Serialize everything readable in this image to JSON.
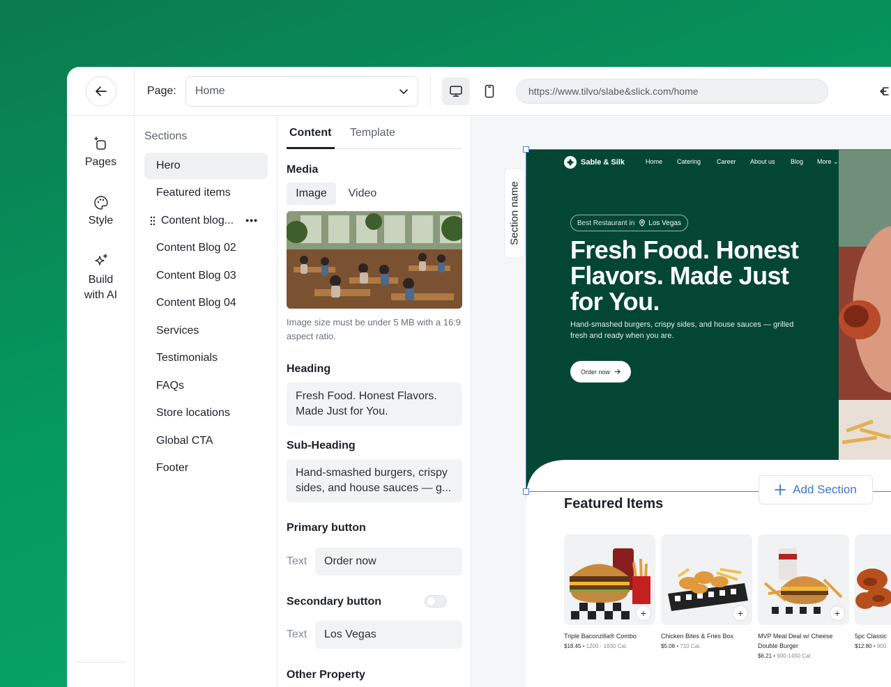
{
  "topbar": {
    "page_label": "Page:",
    "page_value": "Home",
    "url": "https://www.tilvo/slabe&slick.com/home"
  },
  "rail": {
    "pages": "Pages",
    "style": "Style",
    "build_line1": "Build",
    "build_line2": "with AI"
  },
  "sections": {
    "title": "Sections",
    "items": [
      "Hero",
      "Featured items",
      "Content blog...",
      "Content Blog 02",
      "Content Blog 03",
      "Content Blog 04",
      "Services",
      "Testimonials",
      "FAQs",
      "Store locations",
      "Global CTA",
      "Footer"
    ],
    "more_glyph": "•••"
  },
  "panel": {
    "tabs": {
      "content": "Content",
      "template": "Template"
    },
    "media_label": "Media",
    "media_tabs": {
      "image": "Image",
      "video": "Video"
    },
    "media_hint": "Image size must be under 5 MB with a 16:9 aspect ratio.",
    "heading_label": "Heading",
    "heading_value": "Fresh Food. Honest Flavors. Made Just for You.",
    "subheading_label": "Sub-Heading",
    "subheading_value": "Hand-smashed burgers, crispy sides, and house sauces — g...",
    "primary_label": "Primary button",
    "primary_text_label": "Text",
    "primary_text_value": "Order now",
    "secondary_label": "Secondary button",
    "secondary_enabled": false,
    "secondary_text_label": "Text",
    "secondary_text_value": "Los Vegas",
    "other_label": "Other Property"
  },
  "preview": {
    "section_name": "Section name",
    "brand": "Sable & Silk",
    "nav": [
      "Home",
      "Catering",
      "Career",
      "About us",
      "Blog",
      "More"
    ],
    "badge_prefix": "Best Restaurant in",
    "badge_location": "Los Vegas",
    "hero_title": "Fresh Food. Honest Flavors. Made Just for You.",
    "hero_sub": "Hand-smashed burgers, crispy sides, and house sauces — grilled fresh and ready when you are.",
    "hero_button": "Order now",
    "add_section": "Add Section",
    "featured_title": "Featured Items",
    "cards": [
      {
        "name": "Triple Baconzilla® Combo",
        "price": "$18.45",
        "cal": "1200 - 1830 Cal."
      },
      {
        "name": "Chicken Bites & Fries Box",
        "price": "$5.08",
        "cal": "710 Cal."
      },
      {
        "name": "MVP Meal Deal w/ Cheese Double Burger",
        "price": "$6.21",
        "cal": "900-1450 Cal."
      },
      {
        "name": "5pc Classic",
        "price": "$12.80",
        "cal": "900"
      }
    ]
  },
  "colors": {
    "hero_bg": "#044634",
    "accent_blue": "#3a74d6",
    "frame_green": "#05995f"
  }
}
